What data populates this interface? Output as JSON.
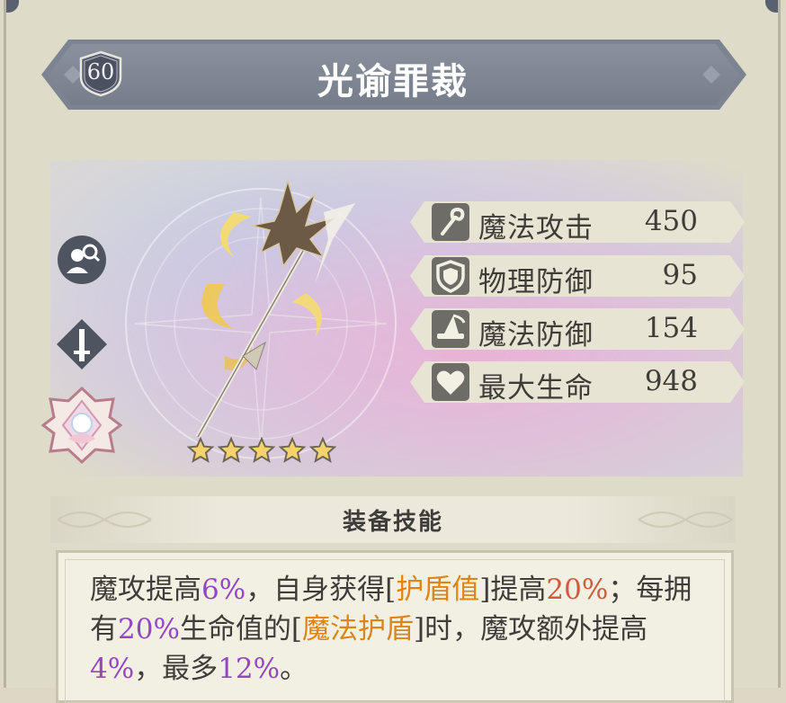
{
  "weapon": {
    "level": "60",
    "name": "光谕罪裁",
    "stars": 5
  },
  "side_icons": [
    "inspect-character-icon",
    "sword-diamond-icon",
    "lotus-emblem-icon"
  ],
  "stats": [
    {
      "icon": "staff-icon",
      "label": "魔法攻击",
      "value": "450"
    },
    {
      "icon": "shield-icon",
      "label": "物理防御",
      "value": "95"
    },
    {
      "icon": "wizard-hat-icon",
      "label": "魔法防御",
      "value": "154"
    },
    {
      "icon": "heart-icon",
      "label": "最大生命",
      "value": "948"
    }
  ],
  "skill": {
    "header": "装备技能",
    "segments": [
      {
        "text": "魔攻提高",
        "style": "plain"
      },
      {
        "text": "6%",
        "style": "purple"
      },
      {
        "text": "，自身获得[",
        "style": "plain"
      },
      {
        "text": "护盾值",
        "style": "orange"
      },
      {
        "text": "]提高",
        "style": "plain"
      },
      {
        "text": "20%",
        "style": "red"
      },
      {
        "text": "；每拥有",
        "style": "plain"
      },
      {
        "text": "20%",
        "style": "purple"
      },
      {
        "text": "生命值的[",
        "style": "plain"
      },
      {
        "text": "魔法护盾",
        "style": "orange"
      },
      {
        "text": "]时，魔攻额外提高",
        "style": "plain"
      },
      {
        "text": "4%",
        "style": "purple"
      },
      {
        "text": "，最多",
        "style": "plain"
      },
      {
        "text": "12%",
        "style": "purple"
      },
      {
        "text": "。",
        "style": "plain"
      }
    ]
  },
  "colors": {
    "title_bar": "#7c8491",
    "highlight_purple": "#9547c2",
    "highlight_orange": "#dc8518",
    "highlight_red": "#d05a3c"
  }
}
